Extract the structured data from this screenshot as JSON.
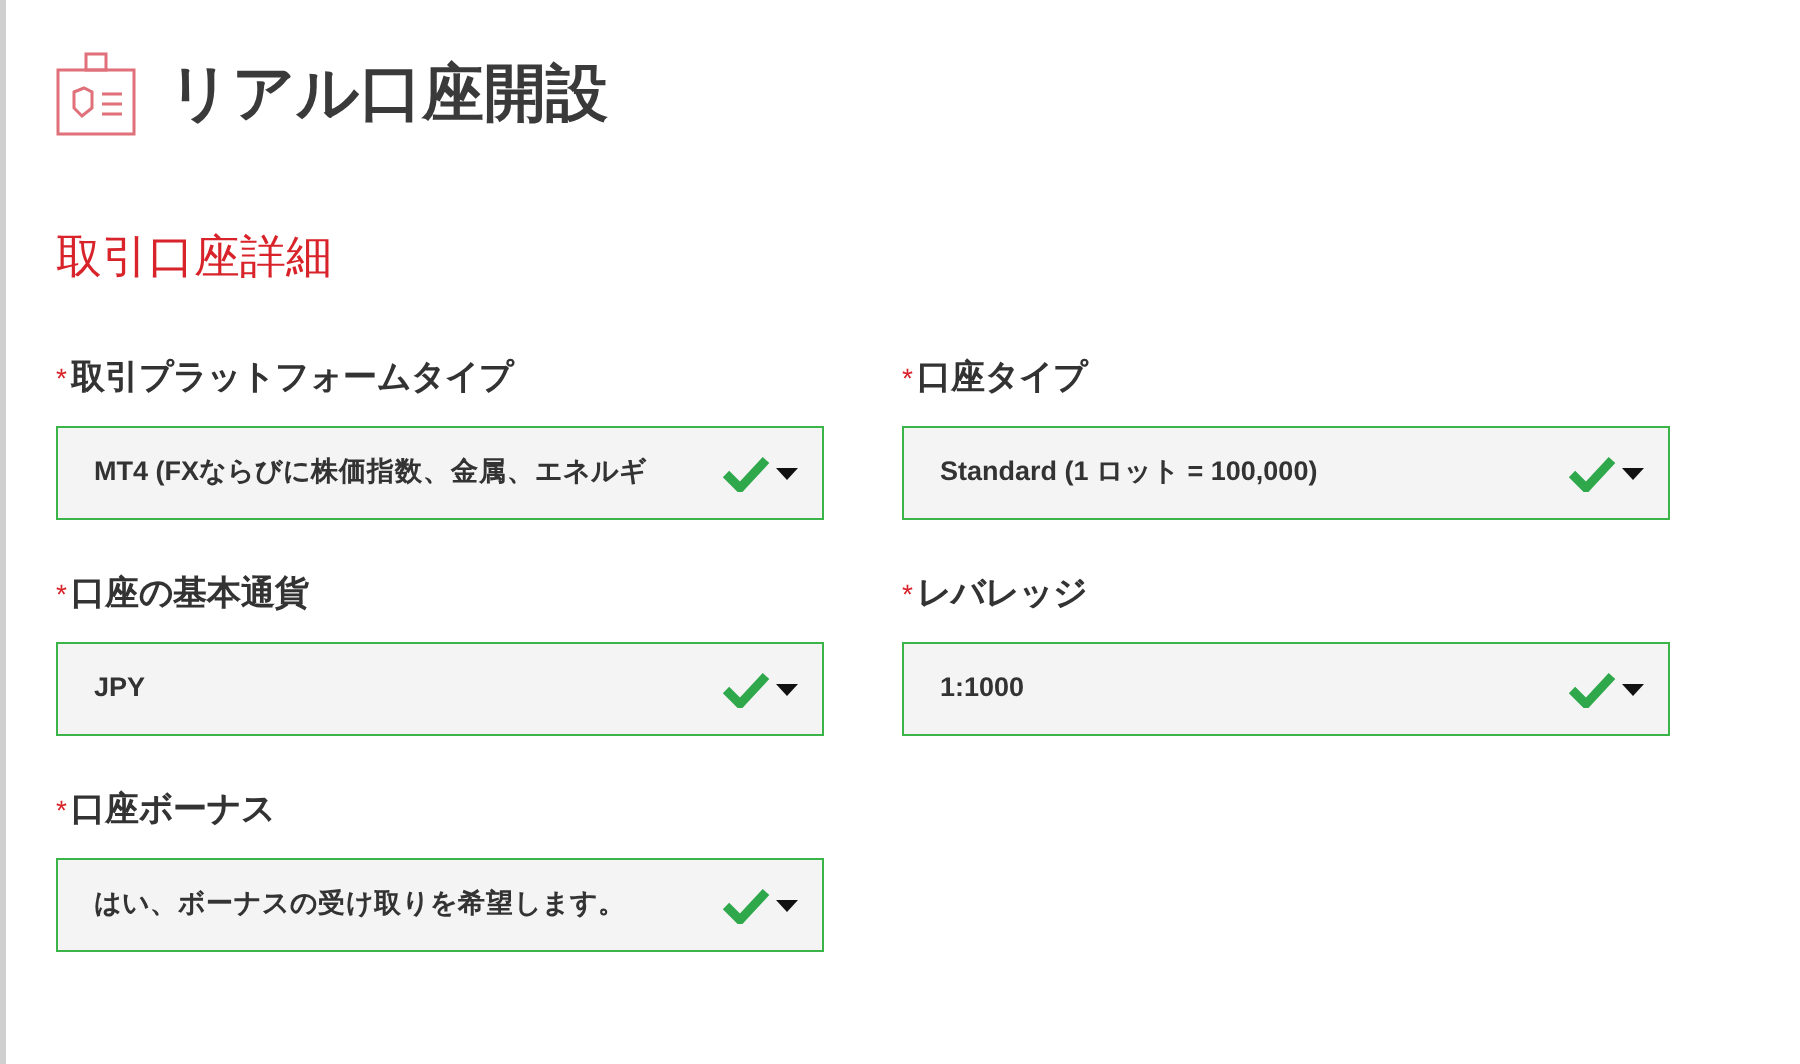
{
  "page_title": "リアル口座開設",
  "section_title": "取引口座詳細",
  "fields": [
    {
      "label": "取引プラットフォームタイプ",
      "required_mark": "*",
      "value": "MT4 (FXならびに株価指数、金属、エネルギ",
      "valid": true
    },
    {
      "label": "口座タイプ",
      "required_mark": "*",
      "value": "Standard (1 ロット = 100,000)",
      "valid": true
    },
    {
      "label": "口座の基本通貨",
      "required_mark": "*",
      "value": "JPY",
      "valid": true
    },
    {
      "label": "レバレッジ",
      "required_mark": "*",
      "value": "1:1000",
      "valid": true
    },
    {
      "label": "口座ボーナス",
      "required_mark": "*",
      "value": "はい、ボーナスの受け取りを希望します。",
      "valid": true
    }
  ]
}
